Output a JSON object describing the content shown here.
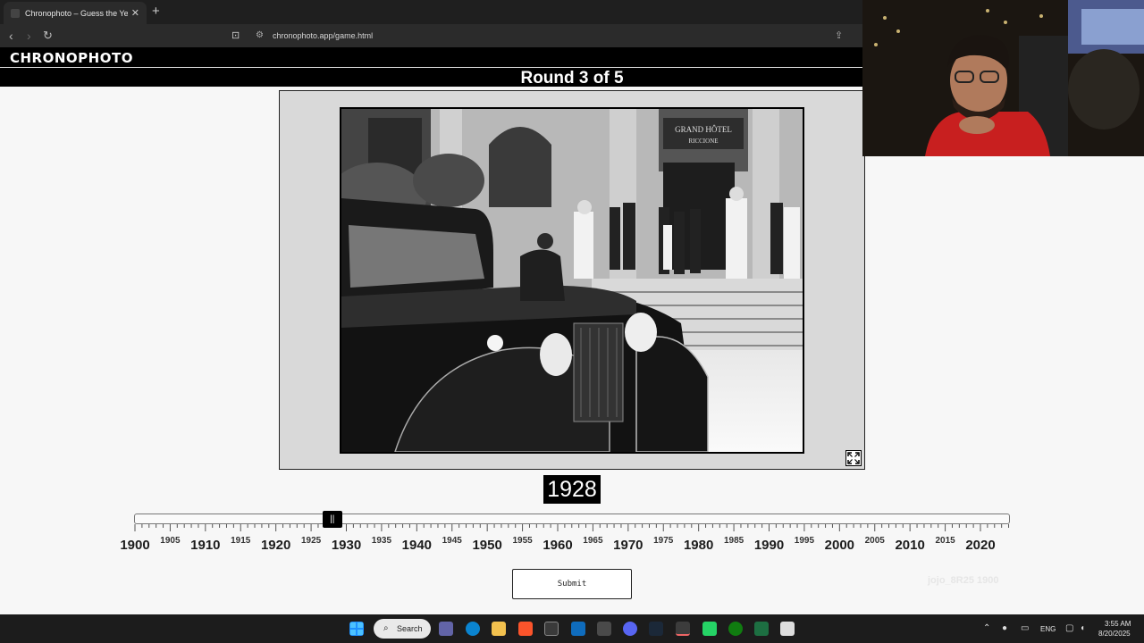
{
  "browser": {
    "tab_title": "Chronophoto – Guess the Year a",
    "tab_close": "✕",
    "new_tab": "+",
    "url": "chronophoto.app/game.html"
  },
  "header": {
    "logo": "CHRONOPHOTO",
    "round": "Round 3 of 5"
  },
  "photo": {
    "sign_line1": "GRAND HÔTEL",
    "sign_line2": "RICCIONE"
  },
  "guess": {
    "year": "1928"
  },
  "slider": {
    "min": 1900,
    "max": 2024,
    "value": 1928,
    "thumb_glyph": "||",
    "major_labels": [
      "1900",
      "1910",
      "1920",
      "1930",
      "1940",
      "1950",
      "1960",
      "1970",
      "1980",
      "1990",
      "2000",
      "2010",
      "2020"
    ],
    "minor_labels": [
      "1905",
      "1915",
      "1925",
      "1935",
      "1945",
      "1955",
      "1965",
      "1975",
      "1985",
      "1995",
      "2005",
      "2015"
    ]
  },
  "submit_label": "Submit",
  "watermark": "jojo_8R25  1900",
  "taskbar": {
    "search_label": "Search",
    "language": "ENG",
    "time": "3:55 AM",
    "date": "8/20/2025",
    "icons": [
      "windows-start",
      "search",
      "teams",
      "edge",
      "file-explorer",
      "brave",
      "store",
      "outlook",
      "steam-unknown",
      "discord",
      "steam",
      "terminal",
      "whatsapp",
      "xbox",
      "excel",
      "notepad"
    ]
  }
}
